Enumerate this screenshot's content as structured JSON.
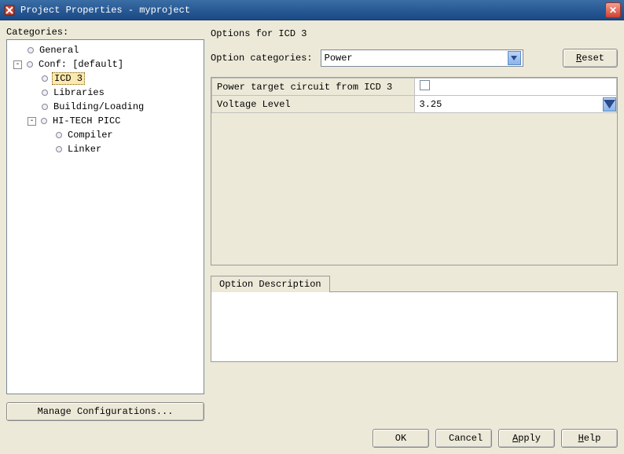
{
  "window": {
    "title": "Project Properties - myproject"
  },
  "sidebar": {
    "label": "Categories:",
    "manage_btn": "Manage Configurations...",
    "items": [
      {
        "label": "General",
        "depth": 1,
        "expander": "",
        "selected": false
      },
      {
        "label": "Conf: [default]",
        "depth": 1,
        "expander": "-",
        "selected": false
      },
      {
        "label": "ICD 3",
        "depth": 2,
        "expander": "",
        "selected": true
      },
      {
        "label": "Libraries",
        "depth": 2,
        "expander": "",
        "selected": false
      },
      {
        "label": "Building/Loading",
        "depth": 2,
        "expander": "",
        "selected": false
      },
      {
        "label": "HI-TECH PICC",
        "depth": 2,
        "expander": "-",
        "selected": false
      },
      {
        "label": "Compiler",
        "depth": 3,
        "expander": "",
        "selected": false
      },
      {
        "label": "Linker",
        "depth": 3,
        "expander": "",
        "selected": false
      }
    ]
  },
  "main": {
    "options_for": "Options for ICD 3",
    "option_categories_label": "Option categories:",
    "option_categories_value": "Power",
    "reset_label": "Reset",
    "rows": [
      {
        "name": "Power target circuit from ICD 3",
        "kind": "checkbox",
        "value": ""
      },
      {
        "name": "Voltage Level",
        "kind": "combo",
        "value": "3.25"
      }
    ],
    "tab_label": "Option Description"
  },
  "footer": {
    "ok": "OK",
    "cancel": "Cancel",
    "apply": "Apply",
    "help": "Help"
  }
}
